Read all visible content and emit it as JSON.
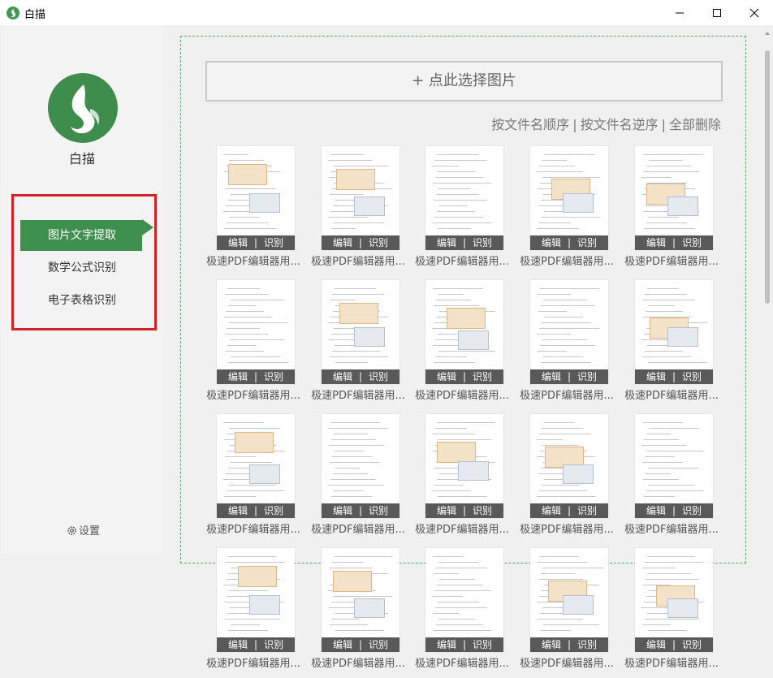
{
  "window": {
    "title": "白描"
  },
  "sidebar": {
    "app_name": "白描",
    "items": [
      {
        "label": "图片文字提取",
        "active": true
      },
      {
        "label": "数学公式识别",
        "active": false
      },
      {
        "label": "电子表格识别",
        "active": false
      }
    ],
    "settings_label": "设置"
  },
  "main": {
    "add_label": "+ 点此选择图片",
    "sort_options": [
      "按文件名顺序",
      "按文件名逆序",
      "全部删除"
    ],
    "sort_separator": "|",
    "close_glyph": "✕",
    "edit_label": "编辑",
    "ocr_label": "识别",
    "action_separator": "|",
    "file_name": "极速PDF编辑器用..."
  },
  "colors": {
    "accent": "#3f8f4f",
    "highlight_border": "#d1222a"
  },
  "icons": [
    "app-logo-icon",
    "minimize-icon",
    "maximize-icon",
    "close-icon",
    "gear-icon",
    "delete-icon",
    "scroll-up-icon"
  ]
}
